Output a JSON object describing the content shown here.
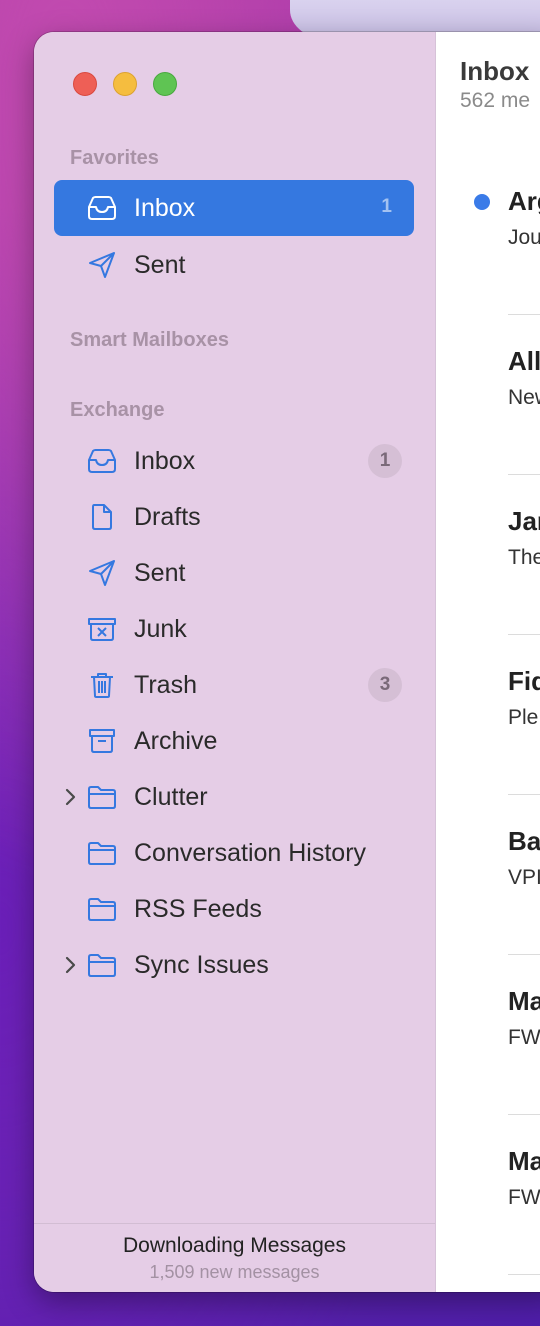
{
  "window": {
    "controls": [
      "close",
      "minimize",
      "zoom"
    ]
  },
  "sidebar": {
    "favorites": {
      "header": "Favorites",
      "items": [
        {
          "label": "Inbox",
          "icon": "tray-icon",
          "badge": "1",
          "selected": true
        },
        {
          "label": "Sent",
          "icon": "paper-plane-icon"
        }
      ]
    },
    "smart_mailboxes": {
      "header": "Smart Mailboxes"
    },
    "exchange": {
      "header": "Exchange",
      "items": [
        {
          "label": "Inbox",
          "icon": "tray-icon",
          "badge": "1"
        },
        {
          "label": "Drafts",
          "icon": "document-icon"
        },
        {
          "label": "Sent",
          "icon": "paper-plane-icon"
        },
        {
          "label": "Junk",
          "icon": "junk-box-icon"
        },
        {
          "label": "Trash",
          "icon": "trash-icon",
          "badge": "3"
        },
        {
          "label": "Archive",
          "icon": "archive-box-icon"
        },
        {
          "label": "Clutter",
          "icon": "folder-icon",
          "expandable": true
        },
        {
          "label": "Conversation History",
          "icon": "folder-icon"
        },
        {
          "label": "RSS Feeds",
          "icon": "folder-icon"
        },
        {
          "label": "Sync Issues",
          "icon": "folder-icon",
          "expandable": true
        }
      ]
    },
    "footer": {
      "status": "Downloading Messages",
      "detail": "1,509 new messages"
    }
  },
  "message_list": {
    "title": "Inbox",
    "subtitle": "562 me",
    "messages": [
      {
        "sender": "Arg",
        "subject": "Jou",
        "unread": true
      },
      {
        "sender": "All",
        "subject": "New",
        "unread": false
      },
      {
        "sender": "Jar",
        "subject": "The",
        "unread": false
      },
      {
        "sender": "Fid",
        "subject": "Ple",
        "unread": false
      },
      {
        "sender": "Ba",
        "subject": "VPI",
        "unread": false
      },
      {
        "sender": "Ma",
        "subject": "FW",
        "unread": false
      },
      {
        "sender": "Ma",
        "subject": "FW",
        "unread": false
      }
    ]
  },
  "colors": {
    "accent": "#3578e0",
    "sidebar_bg": "#e5cde6",
    "unread_dot": "#3a7be8"
  }
}
